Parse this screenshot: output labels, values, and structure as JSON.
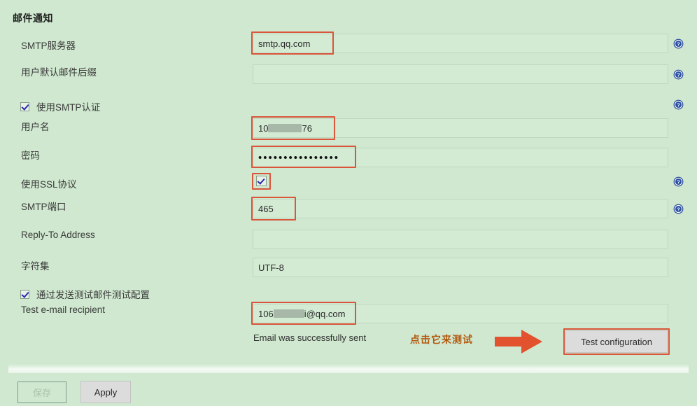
{
  "section": {
    "title": "邮件通知"
  },
  "rows": [
    {
      "label": "SMTP服务器",
      "value": "smtp.qq.com",
      "help": true,
      "highlight": true
    },
    {
      "label": "用户默认邮件后缀",
      "value": "",
      "help": true,
      "highlight": false
    },
    {
      "label": "用户名",
      "value": "10",
      "value_tail": "76",
      "redacted": true,
      "help": false,
      "highlight": true
    },
    {
      "label": "密码",
      "value": "••••••••••••••••",
      "help": false,
      "highlight": true
    },
    {
      "label": "使用SSL协议",
      "value": "",
      "help": true,
      "highlight": true
    },
    {
      "label": "SMTP端口",
      "value": "465",
      "help": true,
      "highlight": true
    },
    {
      "label": "Reply-To Address",
      "value": "",
      "help": false,
      "highlight": false
    },
    {
      "label": "字符集",
      "value": "UTF-8",
      "help": false,
      "highlight": false
    },
    {
      "label": "Test e-mail recipient",
      "value": "106",
      "value_tail": "i@qq.com",
      "redacted": true,
      "help": false,
      "highlight": true
    }
  ],
  "checkboxes": {
    "use_smtp_auth": {
      "label": "使用SMTP认证",
      "checked": true
    },
    "test_by_sending": {
      "label": "通过发送测试邮件测试配置",
      "checked": true
    },
    "use_ssl": {
      "checked": true
    }
  },
  "status": {
    "message": "Email was successfully sent"
  },
  "annotation": {
    "text": "点击它来测试",
    "color": "#b35a10",
    "arrow_color": "#e2522f"
  },
  "buttons": {
    "test_configuration": "Test configuration",
    "save": "保存",
    "apply": "Apply"
  },
  "colors": {
    "page_background": "#cfe8cf",
    "highlight_border": "#d9553b",
    "help_icon": "#2b50a0"
  },
  "icons": {
    "help": "help-circle-icon",
    "arrow": "right-arrow-icon"
  }
}
